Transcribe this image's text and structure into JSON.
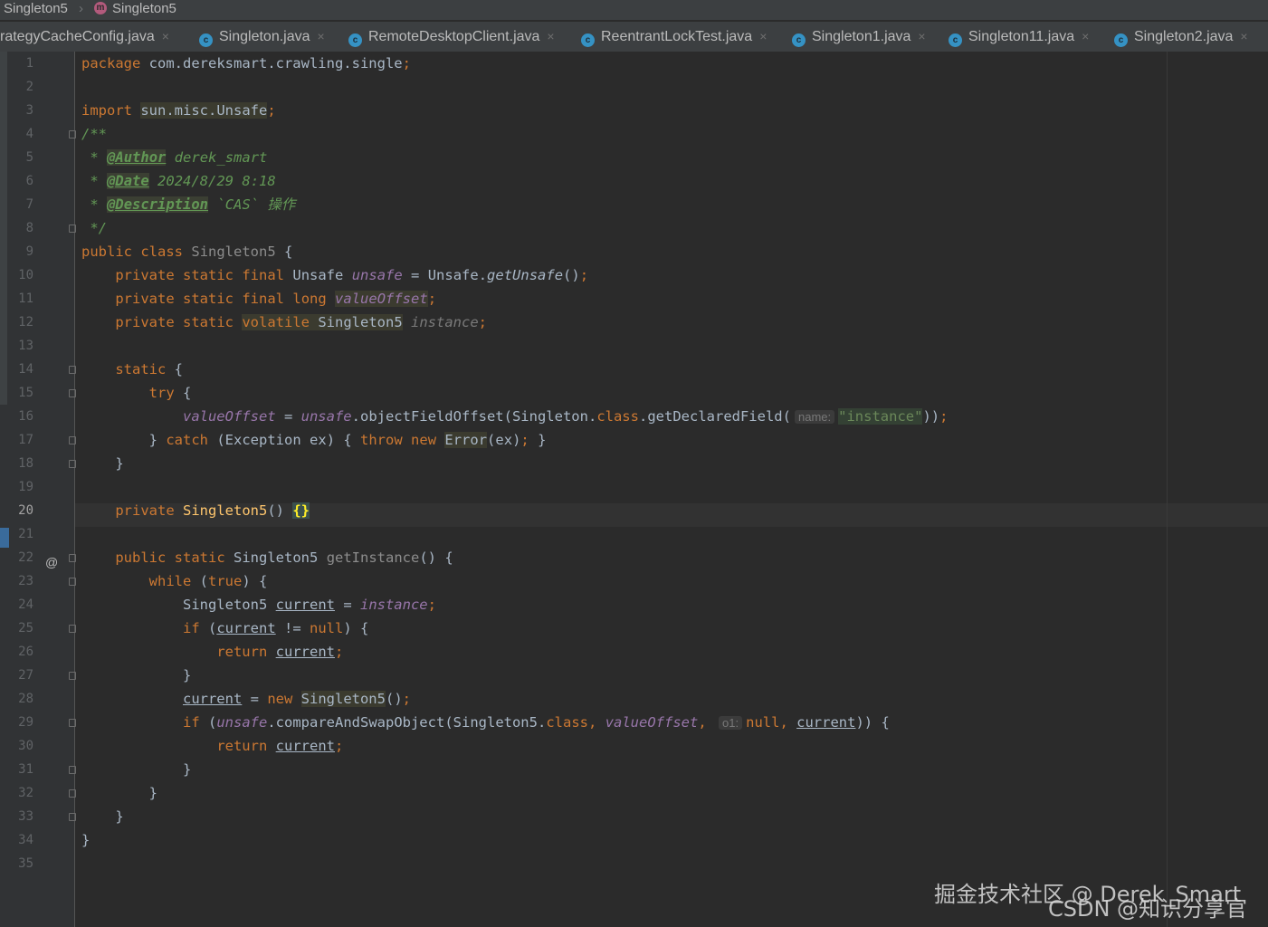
{
  "breadcrumb": {
    "project": "Singleton5",
    "file": "Singleton5"
  },
  "tabs": [
    {
      "label": "rategyCacheConfig.java"
    },
    {
      "label": "Singleton.java"
    },
    {
      "label": "RemoteDesktopClient.java"
    },
    {
      "label": "ReentrantLockTest.java"
    },
    {
      "label": "Singleton1.java"
    },
    {
      "label": "Singleton11.java"
    },
    {
      "label": "Singleton2.java"
    }
  ],
  "editor": {
    "current_line": "20",
    "line_numbers": [
      "1",
      "2",
      "3",
      "4",
      "5",
      "6",
      "7",
      "8",
      "9",
      "10",
      "11",
      "12",
      "13",
      "14",
      "15",
      "16",
      "17",
      "18",
      "19",
      "20",
      "21",
      "22",
      "23",
      "24",
      "25",
      "26",
      "27",
      "28",
      "29",
      "30",
      "31",
      "32",
      "33",
      "34",
      "35"
    ],
    "implements_marker": "@",
    "tokens": {
      "package": "package",
      "package_name": "com.dereksmart.crawling.single",
      "import": "import",
      "import_name": "sun.misc.Unsafe",
      "doc_open": "/**",
      "doc_star": "*",
      "tag_author": "@Author",
      "author_val": "derek_smart",
      "tag_date": "@Date",
      "date_val": "2024/8/29 8:18",
      "tag_desc": "@Description",
      "desc_val": "`CAS` 操作",
      "doc_close": "*/",
      "public": "public",
      "class": "class",
      "class_name": "Singleton5",
      "private": "private",
      "static": "static",
      "final": "final",
      "volatile": "volatile",
      "long": "long",
      "type_unsafe": "Unsafe",
      "f_unsafe": "unsafe",
      "f_valueOffset": "valueOffset",
      "f_instance": "instance",
      "m_getUnsafe": "getUnsafe",
      "try": "try",
      "catch": "catch",
      "throw": "throw",
      "new": "new",
      "error_cls": "Error",
      "exception": "Exception",
      "ex": "ex",
      "m_objectFieldOffset": "objectFieldOffset",
      "singleton": "Singleton",
      "m_getDeclaredField": "getDeclaredField",
      "hint_name": "name:",
      "str_instance": "\"instance\"",
      "m_getInstance": "getInstance",
      "while": "while",
      "true": "true",
      "var_current": "current",
      "if": "if",
      "null": "null",
      "return": "return",
      "m_cas": "compareAndSwapObject",
      "hint_o1": "o1:"
    }
  },
  "watermark": {
    "line1": "掘金技术社区 @ Derek_Smart",
    "line2": "CSDN @知识分享官"
  }
}
